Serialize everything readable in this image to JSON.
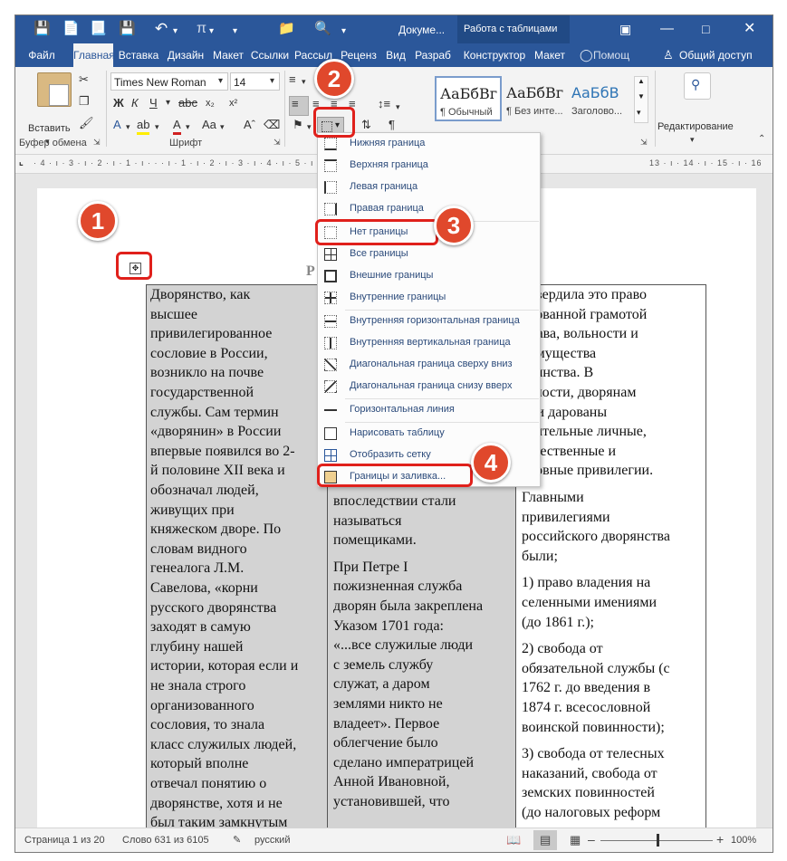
{
  "titlebar": {
    "doc_title": "Докуме...",
    "context_title": "Работа с таблицами",
    "pi_glyph": "π"
  },
  "tabs": [
    {
      "label": "Файл"
    },
    {
      "label": "Главная"
    },
    {
      "label": "Вставка"
    },
    {
      "label": "Дизайн"
    },
    {
      "label": "Макет"
    },
    {
      "label": "Ссылки"
    },
    {
      "label": "Рассыл"
    },
    {
      "label": "Реценз"
    },
    {
      "label": "Вид"
    },
    {
      "label": "Разраб"
    },
    {
      "label": "Конструктор"
    },
    {
      "label": "Макет"
    }
  ],
  "tell_me": "Помощ",
  "share": "Общий доступ",
  "ribbon": {
    "clipboard": {
      "paste": "Вставить",
      "group_label": "Буфер обмена"
    },
    "font": {
      "name": "Times New Roman",
      "size": "14",
      "group_label": "Шрифт"
    },
    "styles": [
      {
        "sample": "АаБбВг",
        "name": "¶ Обычный"
      },
      {
        "sample": "АаБбВг",
        "name": "¶ Без инте..."
      },
      {
        "sample": "АаБбВ",
        "name": "Заголово..."
      }
    ],
    "editing": {
      "label": "Редактирование"
    }
  },
  "ruler_text": "· 4 · ı · 3 · ı · 2 · ı · 1 · ı · · · ı · 1 · ı · 2 · ı · 3 · ı · 4 · ı · 5 · ı · 6 · ı ·",
  "ruler_right": "13 · ı · 14 · ı · 15 · ı · 16",
  "document": {
    "heading_fragment": "Р",
    "col1": [
      "Дворянство, как",
      "высшее",
      "привилегированное",
      "сословие в России,",
      "возникло на почве",
      "государственной",
      "службы. Сам термин",
      "«дворянин» в России",
      "впервые появился во 2-",
      "й половине XII века и",
      "обозначал людей,",
      "живущих при",
      "княжеском дворе. По",
      "словам видного",
      "генеалога Л.М.",
      "Савелова, «корни",
      "русского дворянства",
      "заходят в самую",
      "глубину нашей",
      "истории, которая если и",
      "не знала строго",
      "организованного",
      "сословия, то знала",
      "класс служилых людей,",
      "который вполне",
      "отвечал понятию о",
      "дворянстве, хотя и не",
      "был таким замкнутым"
    ],
    "col2_p1": [
      "впоследствии стали",
      "называться",
      "помещиками."
    ],
    "col2_p2": [
      "При Петре I",
      "пожизненная служба",
      "дворян была закреплена",
      "Указом 1701 года:",
      "«...все служилые люди",
      "с земель службу",
      "служат, а даром",
      "землями никто не",
      "владеет». Первое",
      "облегчение было",
      "сделано императрицей",
      "Анной Ивановной,",
      "установившей, что"
    ],
    "col3_p1": [
      "дтвердила это право",
      "алованной грамотой",
      "права, вольности и",
      "еимущества",
      "орянства. В",
      "стности, дворянам",
      "или дарованы",
      "ачительные личные,",
      "ущественные и",
      "словные привилегии."
    ],
    "col3_p2": [
      "Главными",
      "привилегиями",
      "российского дворянства",
      "были;"
    ],
    "col3_p3": [
      "1) право владения на",
      "селенными имениями",
      "(до 1861 г.);"
    ],
    "col3_p4": [
      "2) свобода от",
      "обязательной службы (с",
      "1762 г. до введения в",
      "1874 г. всесословной",
      "воинской повинности);"
    ],
    "col3_p5": [
      "3) свобода от телесных",
      "наказаний, свобода от",
      "земских повинностей",
      "(до налоговых реформ"
    ]
  },
  "borders_menu": {
    "items": [
      {
        "label": "Нижняя граница",
        "icon": "border-bottom-icon"
      },
      {
        "label": "Верхняя граница",
        "icon": "border-top-icon"
      },
      {
        "label": "Левая граница",
        "icon": "border-left-icon"
      },
      {
        "label": "Правая граница",
        "icon": "border-right-icon"
      },
      {
        "label": "Нет границы",
        "icon": "no-border-icon"
      },
      {
        "label": "Все границы",
        "icon": "all-borders-icon"
      },
      {
        "label": "Внешние границы",
        "icon": "outside-borders-icon"
      },
      {
        "label": "Внутренние границы",
        "icon": "inside-borders-icon"
      },
      {
        "label": "Внутренняя горизонтальная граница",
        "icon": "inside-horizontal-border-icon"
      },
      {
        "label": "Внутренняя вертикальная граница",
        "icon": "inside-vertical-border-icon"
      },
      {
        "label": "Диагональная граница сверху вниз",
        "icon": "diagonal-down-border-icon"
      },
      {
        "label": "Диагональная граница снизу вверх",
        "icon": "diagonal-up-border-icon"
      },
      {
        "label": "Горизонтальная линия",
        "icon": "horizontal-line-icon"
      },
      {
        "label": "Нарисовать таблицу",
        "icon": "draw-table-icon"
      },
      {
        "label": "Отобразить сетку",
        "icon": "view-gridlines-icon"
      },
      {
        "label": "Границы и заливка...",
        "icon": "borders-shading-icon"
      }
    ]
  },
  "status": {
    "page": "Страница 1 из 20",
    "words": "Слово 631 из 6105",
    "language": "русский",
    "zoom": "100%"
  },
  "callouts": [
    "1",
    "2",
    "3",
    "4"
  ],
  "colors": {
    "accent": "#2b579a",
    "callout": "#e0482c",
    "highlight": "#e0201b",
    "cell_shading": "#d3d3d3"
  }
}
